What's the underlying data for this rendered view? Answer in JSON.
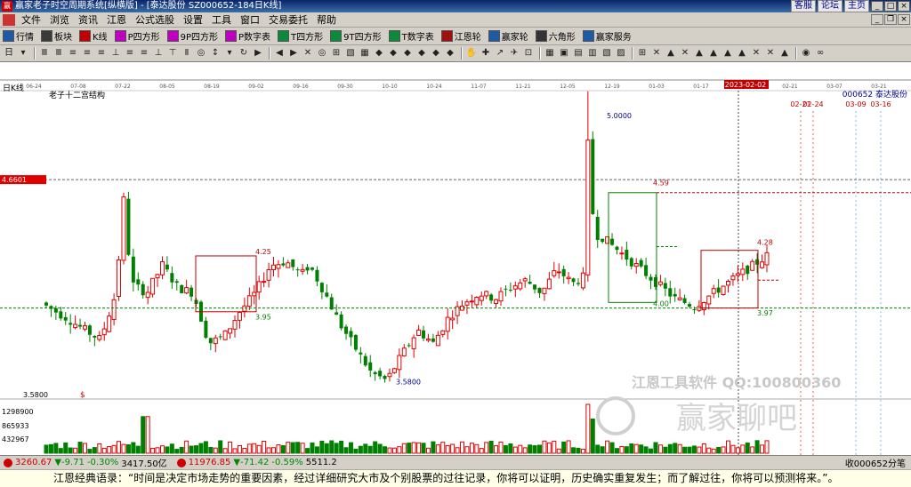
{
  "window": {
    "title": "赢家老子时空周期系统[纵横版] - [泰达股份   SZ000652-184日K线]",
    "links": [
      "客服",
      "论坛",
      "主页"
    ]
  },
  "menu": [
    "文件",
    "浏览",
    "资讯",
    "江恩",
    "公式选股",
    "设置",
    "工具",
    "窗口",
    "交易委托",
    "帮助"
  ],
  "toolbar1": [
    {
      "label": "行情",
      "color": "#1f5aa6"
    },
    {
      "label": "板块",
      "color": "#3a3a3a"
    },
    {
      "label": "K线",
      "color": "#c00000"
    },
    {
      "label": "P四方形",
      "color": "#c000c0"
    },
    {
      "label": "9P四方形",
      "color": "#c000c0"
    },
    {
      "label": "P数字表",
      "color": "#c000c0"
    },
    {
      "label": "T四方形",
      "color": "#0a8a3a"
    },
    {
      "label": "9T四方形",
      "color": "#0a8a3a"
    },
    {
      "label": "T数字表",
      "color": "#0a8a3a"
    },
    {
      "label": "江恩轮",
      "color": "#a01010"
    },
    {
      "label": "赢家轮",
      "color": "#1f5aa6"
    },
    {
      "label": "六角形",
      "color": "#333333"
    },
    {
      "label": "赢家服务",
      "color": "#1f5aa6"
    }
  ],
  "chart_data": {
    "type": "candlestick",
    "period_label": "日K线",
    "structure_label": "老子十二宫结构",
    "stock_label": "000652 泰达股份",
    "date_ticks": [
      "06-24",
      "07-08",
      "07-22",
      "08-05",
      "08-19",
      "09-02",
      "09-16",
      "09-30",
      "10-10",
      "10-24",
      "11-07",
      "11-21",
      "12-05",
      "12-19",
      "01-03",
      "01-17",
      "2023-02-02",
      "02-21",
      "03-07",
      "03-21"
    ],
    "cursor_date": "2023-02-02",
    "projection_dates": [
      "02-21",
      "02-24",
      "03-09",
      "03-16"
    ],
    "price_min": 3.5,
    "price_max": 5.1,
    "crosshair_price": "4.6601",
    "price_labels": [
      "3.5800",
      "1298900",
      "865933",
      "432967"
    ],
    "annotations": [
      "4.25",
      "3.95",
      "3.5800",
      "5.0000",
      "4.59",
      "4.00",
      "4.28",
      "3.97"
    ],
    "candles_note": "approximate daily OHLC series from 06-24 to 02-10",
    "volume_note": "volume bars below price pane"
  },
  "watermark": {
    "line1": "江恩工具软件  QQ:100800360",
    "line2": "赢家聊吧"
  },
  "status": {
    "sh_index": "3260.67",
    "sh_change": "▼-9.71",
    "sh_pct": "-0.30%",
    "sh_amount": "3417.50亿",
    "sz_index": "11976.85",
    "sz_change": "▼-71.42",
    "sz_pct": "-0.59%",
    "sz_amount": "5511.2",
    "right": "收000652分笔"
  },
  "quote": "江恩经典语录：“时间是决定市场走势的重要因素，经过详细研究大市及个别股票的过往记录，你将可以证明，历史确实重复发生；而了解过往，你将可以预测将来。”。"
}
